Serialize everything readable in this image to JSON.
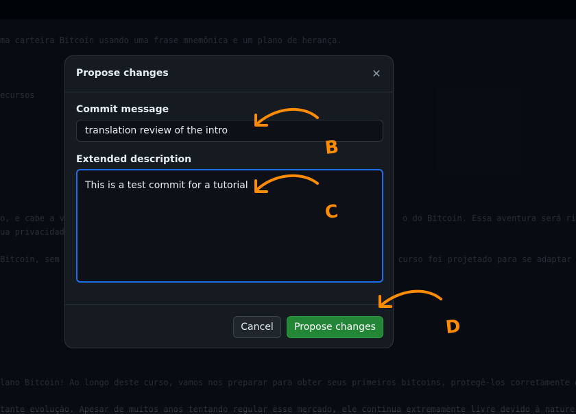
{
  "background": {
    "lines": [
      "ma carteira Bitcoin usando uma frase mnemônica e um plano de herança.",
      "ecursos",
      "o, e cabe a vo",
      "o do Bitcoin. Essa aventura será rica",
      "ua privacidad",
      "Bitcoin, sem",
      "e curso foi projetado para se adaptar",
      "lano Bitcoin! Ao longo deste curso, vamos nos preparar para obter seus primeiros bitcoins, protegê-los corretamente e",
      "tante evolução. Apesar de muitos anos tentando regular esse mercado, ele continua extremamente livre devido à nature"
    ]
  },
  "modal": {
    "title": "Propose changes",
    "close_icon": "close-icon",
    "commit_label": "Commit message",
    "commit_value": "translation review of the intro",
    "description_label": "Extended description",
    "description_value": "This is a test commit for a tutorial",
    "cancel_label": "Cancel",
    "propose_label": "Propose changes"
  },
  "annotations": {
    "color": "#ff8c00",
    "letters": [
      "B",
      "C",
      "D"
    ]
  },
  "colors": {
    "accent_blue": "#1f6feb",
    "success_green": "#238636"
  }
}
